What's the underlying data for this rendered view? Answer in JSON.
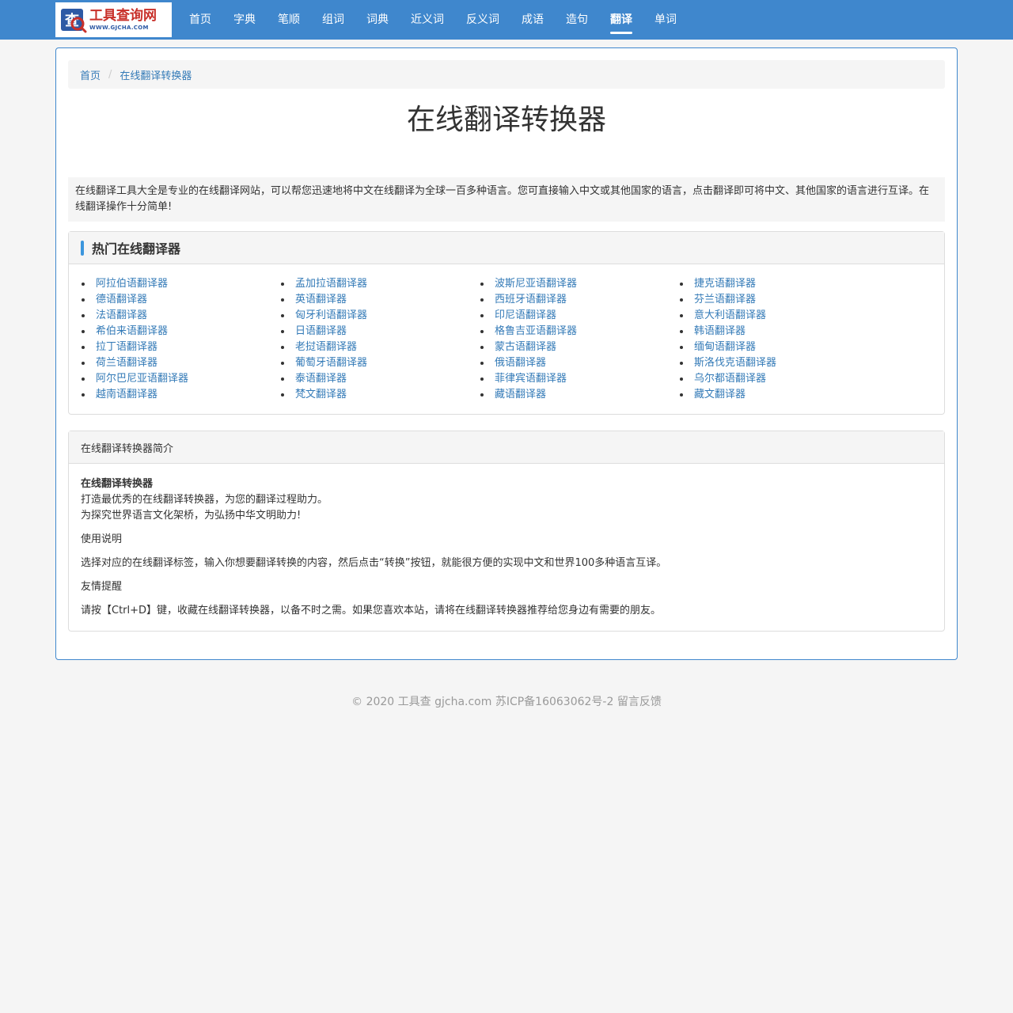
{
  "logo": {
    "title": "工具查询网",
    "url": "WWW.GJCHA.COM",
    "icon": "search-icon"
  },
  "nav": [
    {
      "label": "首页",
      "active": false
    },
    {
      "label": "字典",
      "active": false
    },
    {
      "label": "笔顺",
      "active": false
    },
    {
      "label": "组词",
      "active": false
    },
    {
      "label": "词典",
      "active": false
    },
    {
      "label": "近义词",
      "active": false
    },
    {
      "label": "反义词",
      "active": false
    },
    {
      "label": "成语",
      "active": false
    },
    {
      "label": "造句",
      "active": false
    },
    {
      "label": "翻译",
      "active": true
    },
    {
      "label": "单词",
      "active": false
    }
  ],
  "breadcrumb": {
    "home": "首页",
    "current": "在线翻译转换器",
    "separator": "/"
  },
  "page_title": "在线翻译转换器",
  "intro": "在线翻译工具大全是专业的在线翻译网站，可以帮您迅速地将中文在线翻译为全球一百多种语言。您可直接输入中文或其他国家的语言，点击翻译即可将中文、其他国家的语言进行互译。在线翻译操作十分简单!",
  "hot": {
    "title": "热门在线翻译器",
    "columns": [
      [
        "阿拉伯语翻译器",
        "德语翻译器",
        "法语翻译器",
        "希伯来语翻译器",
        "拉丁语翻译器",
        "荷兰语翻译器",
        "阿尔巴尼亚语翻译器",
        "越南语翻译器"
      ],
      [
        "孟加拉语翻译器",
        "英语翻译器",
        "匈牙利语翻译器",
        "日语翻译器",
        "老挝语翻译器",
        "葡萄牙语翻译器",
        "泰语翻译器",
        "梵文翻译器"
      ],
      [
        "波斯尼亚语翻译器",
        "西班牙语翻译器",
        "印尼语翻译器",
        "格鲁吉亚语翻译器",
        "蒙古语翻译器",
        "俄语翻译器",
        "菲律宾语翻译器",
        "藏语翻译器"
      ],
      [
        "捷克语翻译器",
        "芬兰语翻译器",
        "意大利语翻译器",
        "韩语翻译器",
        "缅甸语翻译器",
        "斯洛伐克语翻译器",
        "乌尔都语翻译器",
        "藏文翻译器"
      ]
    ]
  },
  "about": {
    "header": "在线翻译转换器简介",
    "name": "在线翻译转换器",
    "line1": "打造最优秀的在线翻译转换器，为您的翻译过程助力。",
    "line2": "为探究世界语言文化架桥，为弘扬中华文明助力!",
    "usage_title": "使用说明",
    "usage_text": "选择对应的在线翻译标签，输入你想要翻译转换的内容，然后点击“转换”按钮，就能很方便的实现中文和世界100多种语言互译。",
    "tip_title": "友情提醒",
    "tip_text": "请按【Ctrl+D】键，收藏在线翻译转换器，以备不时之需。如果您喜欢本站，请将在线翻译转换器推荐给您身边有需要的朋友。"
  },
  "footer": "© 2020 工具查 gjcha.com 苏ICP备16063062号-2 留言反馈",
  "colors": {
    "navbar": "#3f87cd",
    "link": "#337ab7",
    "accent_bar": "#3c96dd"
  }
}
